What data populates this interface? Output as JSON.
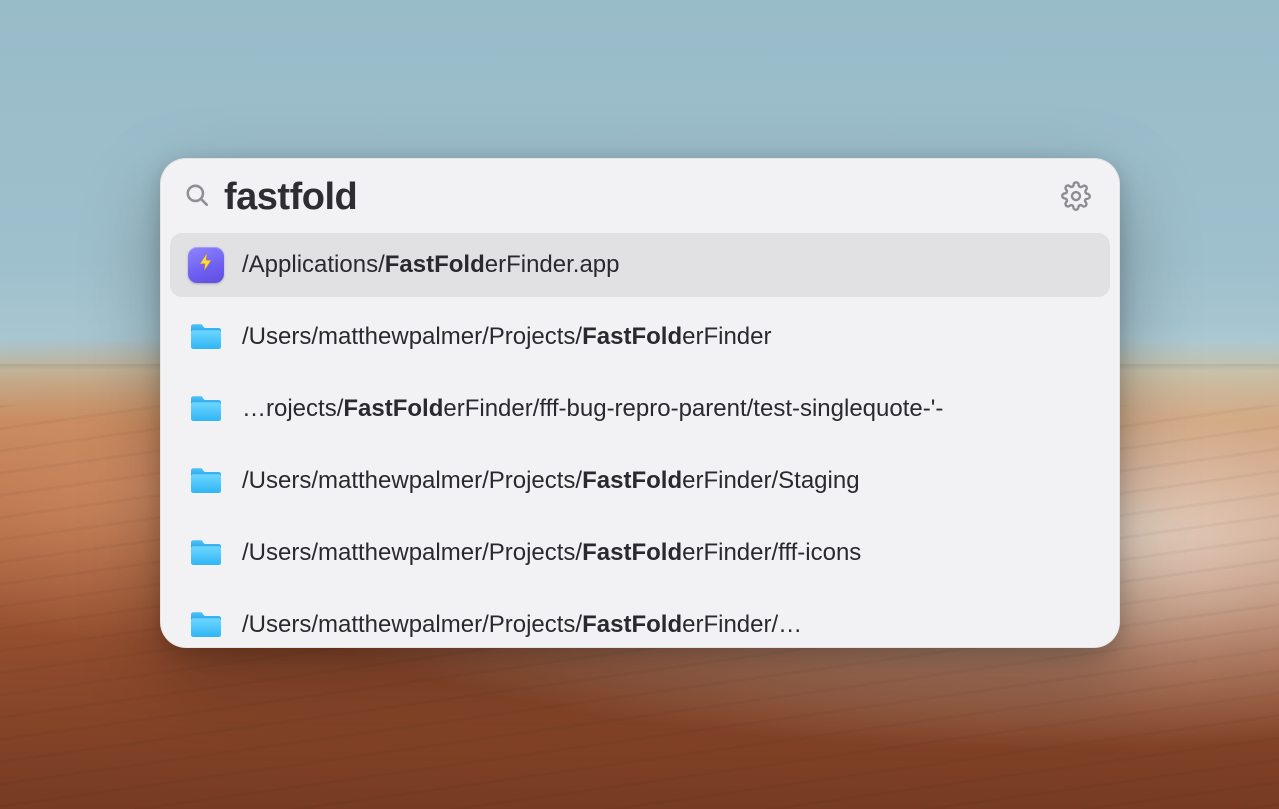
{
  "search": {
    "query": "fastfold",
    "placeholder": ""
  },
  "results": [
    {
      "icon": "app",
      "selected": true,
      "segments": [
        {
          "text": "/Applications/",
          "bold": false
        },
        {
          "text": "FastFold",
          "bold": true
        },
        {
          "text": "erFinder.app",
          "bold": false
        }
      ]
    },
    {
      "icon": "folder",
      "selected": false,
      "segments": [
        {
          "text": "/Users/matthewpalmer/Projects/",
          "bold": false
        },
        {
          "text": "FastFold",
          "bold": true
        },
        {
          "text": "erFinder",
          "bold": false
        }
      ]
    },
    {
      "icon": "folder",
      "selected": false,
      "segments": [
        {
          "text": "…rojects/",
          "bold": false
        },
        {
          "text": "FastFold",
          "bold": true
        },
        {
          "text": "erFinder/fff-bug-repro-parent/test-singlequote-'-",
          "bold": false
        }
      ]
    },
    {
      "icon": "folder",
      "selected": false,
      "segments": [
        {
          "text": "/Users/matthewpalmer/Projects/",
          "bold": false
        },
        {
          "text": "FastFold",
          "bold": true
        },
        {
          "text": "erFinder/Staging",
          "bold": false
        }
      ]
    },
    {
      "icon": "folder",
      "selected": false,
      "segments": [
        {
          "text": "/Users/matthewpalmer/Projects/",
          "bold": false
        },
        {
          "text": "FastFold",
          "bold": true
        },
        {
          "text": "erFinder/fff-icons",
          "bold": false
        }
      ]
    },
    {
      "icon": "folder",
      "selected": false,
      "segments": [
        {
          "text": "/Users/matthewpalmer/Projects/",
          "bold": false
        },
        {
          "text": "FastFold",
          "bold": true
        },
        {
          "text": "erFinder/…",
          "bold": false
        }
      ]
    }
  ]
}
